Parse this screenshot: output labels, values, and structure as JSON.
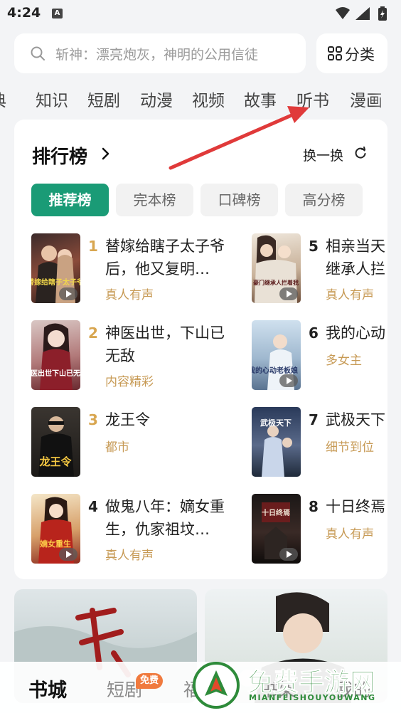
{
  "status_bar": {
    "time": "4:24",
    "app_icon": "A"
  },
  "search": {
    "placeholder": "斩神：漂亮炮灰，神明的公用信徒"
  },
  "category_button": {
    "label": "分类"
  },
  "channels": [
    "典",
    "知识",
    "短剧",
    "动漫",
    "视频",
    "故事",
    "听书",
    "漫画"
  ],
  "ranking": {
    "title": "排行榜",
    "refresh_label": "换一换",
    "tabs": [
      {
        "label": "推荐榜",
        "active": true
      },
      {
        "label": "完本榜",
        "active": false
      },
      {
        "label": "口碑榜",
        "active": false
      },
      {
        "label": "高分榜",
        "active": false
      }
    ],
    "items": [
      {
        "rank": "1",
        "title": "替嫁给瞎子太子爷后，他又复明…",
        "tag": "真人有声",
        "cover_text": "替嫁给瞎子太子爷"
      },
      {
        "rank": "2",
        "title": "神医出世，下山已无敌",
        "tag": "内容精彩",
        "cover_text": "神医出世下山已无敌"
      },
      {
        "rank": "3",
        "title": "龙王令",
        "tag": "都市",
        "cover_text": "龙王令"
      },
      {
        "rank": "4",
        "title": "做鬼八年：嫡女重生，仇家祖坟…",
        "tag": "真人有声",
        "cover_text": "嫡女重生"
      },
      {
        "rank": "5",
        "title": "相亲当天继承人拦着我",
        "tag": "真人有声",
        "cover_text": "豪门继承人拦着我"
      },
      {
        "rank": "6",
        "title": "我的心动老板娘",
        "tag": "多女主",
        "cover_text": "我的心动老板娘"
      },
      {
        "rank": "7",
        "title": "武极天下",
        "tag": "细节到位",
        "cover_text": "武极天下"
      },
      {
        "rank": "8",
        "title": "十日终焉",
        "tag": "真人有声",
        "cover_text": "十日终焉"
      }
    ]
  },
  "bottom_nav": {
    "items": [
      {
        "label": "书城",
        "active": true
      },
      {
        "label": "短剧",
        "active": false
      },
      {
        "label": "福利",
        "active": false
      },
      {
        "label": "书架",
        "active": false
      },
      {
        "label": "我的",
        "active": false
      }
    ],
    "free_badge": "免费"
  },
  "watermark": {
    "text": "免费手游网",
    "sub": "MIANFEISHOUYOUWANG"
  },
  "colors": {
    "accent": "#1a9b76",
    "tag": "#c79a55",
    "rank_gold": "#d8a650",
    "annotation_arrow": "#e03a3a"
  }
}
